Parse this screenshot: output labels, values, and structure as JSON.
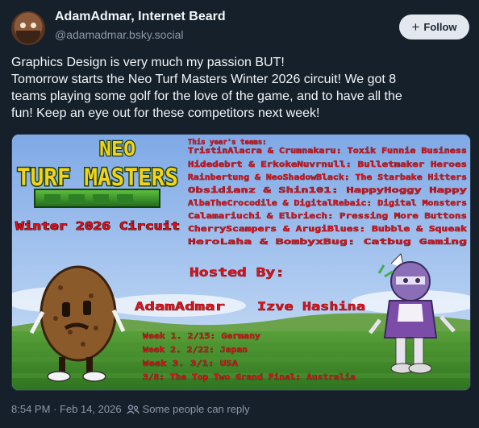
{
  "author": {
    "display_name": "AdamAdmar, Internet Beard",
    "handle": "@adamadmar.bsky.social",
    "avatar_icon": "bearded-face-avatar"
  },
  "follow_button": {
    "label": "Follow",
    "icon": "plus-icon"
  },
  "post": {
    "lines": [
      "Graphics Design is very much my passion BUT!",
      "Tomorrow starts the Neo Turf Masters Winter 2026 circuit! We got 8",
      "teams playing some golf for the love of the game, and to have all the",
      "fun! Keep an eye out for these competitors next week!"
    ]
  },
  "image": {
    "logo": {
      "neo": "NEO",
      "turf_masters": "TURF MASTERS",
      "circuit": "Winter 2026 Circuit"
    },
    "teams_heading": "This year's teams:",
    "teams": [
      "TristinAlacra & Crumnakaru: Toxik Funnie Business",
      "Hidedebrt & ErkokeNuvrnull: Bulletmaker Heroes",
      "Rainbertung & NeoShadowBlack: The Starbake Hitters",
      "Obsidianz & Shin101: HappyHoggy Happy",
      "AlbaTheCrocodile & DigitalRebaic: Digital Monsters",
      "Calamariuchi & Elbriech: Pressing More Buttons",
      "CherryScampers & ArugiBlues: Bubble & Squeak",
      "HeroLaha & BombyxBug: Catbug Gaming"
    ],
    "hosted_by": "Hosted By:",
    "hosts": [
      "AdamAdmar",
      "Izve Hashina"
    ],
    "schedule": [
      "Week 1. 2/15: Germany",
      "Week 2. 2/22: Japan",
      "Week 3. 3/1: USA",
      "3/8: The Top Two Grand Final: Australia"
    ],
    "colors": {
      "sky": "#8fb6ea",
      "grass": "#3f8a2a",
      "text_red": "#d8141c",
      "logo_yellow": "#f3d21c",
      "logo_green": "#3a9b2c"
    }
  },
  "footer": {
    "timestamp": "8:54 PM · Feb 14, 2026",
    "reply_setting": "Some people can reply",
    "reply_icon": "people-icon"
  }
}
